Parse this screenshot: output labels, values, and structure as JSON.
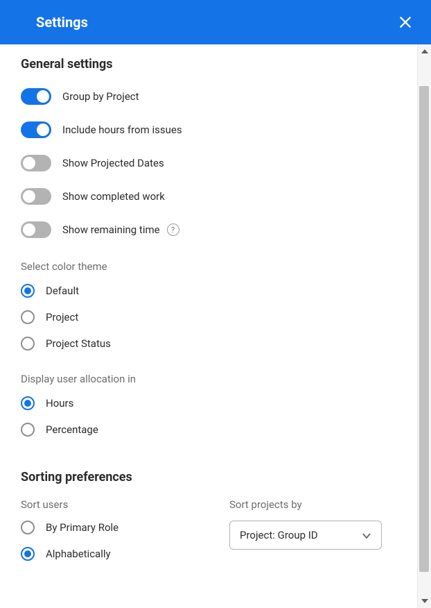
{
  "header": {
    "title": "Settings"
  },
  "general": {
    "title": "General settings",
    "toggles": [
      {
        "label": "Group by Project",
        "on": true
      },
      {
        "label": "Include hours from issues",
        "on": true
      },
      {
        "label": "Show Projected Dates",
        "on": false
      },
      {
        "label": "Show completed work",
        "on": false
      },
      {
        "label": "Show remaining time",
        "on": false,
        "help": true
      }
    ],
    "color_theme": {
      "label": "Select color theme",
      "options": [
        {
          "label": "Default",
          "selected": true
        },
        {
          "label": "Project",
          "selected": false
        },
        {
          "label": "Project Status",
          "selected": false
        }
      ]
    },
    "allocation": {
      "label": "Display user allocation in",
      "options": [
        {
          "label": "Hours",
          "selected": true
        },
        {
          "label": "Percentage",
          "selected": false
        }
      ]
    }
  },
  "sorting": {
    "title": "Sorting preferences",
    "users": {
      "label": "Sort users",
      "options": [
        {
          "label": "By Primary Role",
          "selected": false
        },
        {
          "label": "Alphabetically",
          "selected": true
        }
      ]
    },
    "projects": {
      "label": "Sort projects by",
      "selected": "Project: Group ID"
    }
  }
}
